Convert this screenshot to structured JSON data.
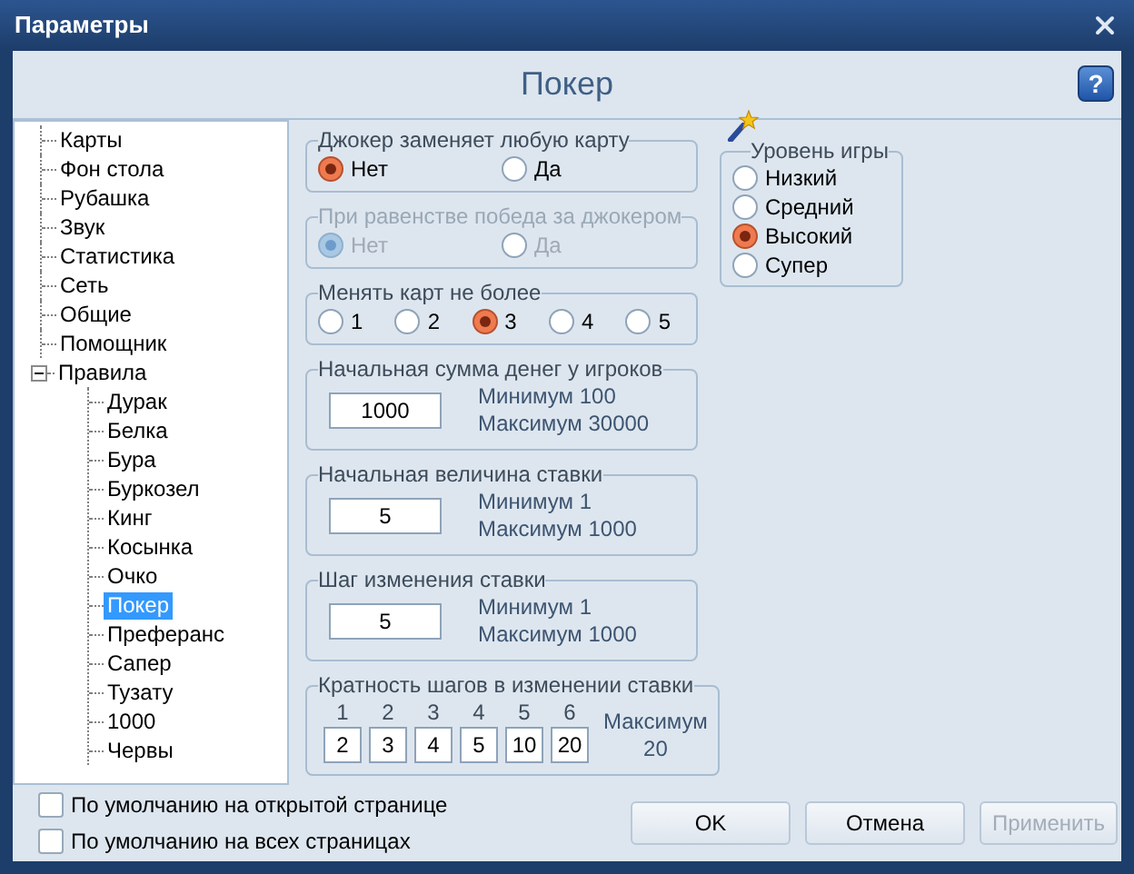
{
  "window": {
    "title": "Параметры"
  },
  "header": {
    "title": "Покер",
    "help": "?"
  },
  "tree": [
    {
      "label": "Карты",
      "selected": false
    },
    {
      "label": "Фон стола",
      "selected": false
    },
    {
      "label": "Рубашка",
      "selected": false
    },
    {
      "label": "Звук",
      "selected": false
    },
    {
      "label": "Статистика",
      "selected": false
    },
    {
      "label": "Сеть",
      "selected": false
    },
    {
      "label": "Общие",
      "selected": false
    },
    {
      "label": "Помощник",
      "selected": false
    },
    {
      "label": "Правила",
      "selected": false,
      "expanded": true,
      "children": [
        {
          "label": "Дурак",
          "selected": false
        },
        {
          "label": "Белка",
          "selected": false
        },
        {
          "label": "Бура",
          "selected": false
        },
        {
          "label": "Буркозел",
          "selected": false
        },
        {
          "label": "Кинг",
          "selected": false
        },
        {
          "label": "Косынка",
          "selected": false
        },
        {
          "label": "Очко",
          "selected": false
        },
        {
          "label": "Покер",
          "selected": true
        },
        {
          "label": "Преферанс",
          "selected": false
        },
        {
          "label": "Сапер",
          "selected": false
        },
        {
          "label": "Тузату",
          "selected": false
        },
        {
          "label": "1000",
          "selected": false
        },
        {
          "label": "Червы",
          "selected": false
        }
      ]
    }
  ],
  "groups": [
    {
      "kind": "radio",
      "legend": "Джокер заменяет любую карту",
      "disabled": false,
      "options": [
        {
          "label": "Нет",
          "selected": true
        },
        {
          "label": "Да",
          "selected": false
        }
      ]
    },
    {
      "kind": "radio",
      "legend": "При равенстве победа за джокером",
      "disabled": true,
      "options": [
        {
          "label": "Нет",
          "selected": true
        },
        {
          "label": "Да",
          "selected": false
        }
      ]
    },
    {
      "kind": "radio",
      "legend": "Менять карт не более",
      "disabled": false,
      "options": [
        {
          "label": "1",
          "selected": false
        },
        {
          "label": "2",
          "selected": false
        },
        {
          "label": "3",
          "selected": true
        },
        {
          "label": "4",
          "selected": false
        },
        {
          "label": "5",
          "selected": false
        }
      ]
    },
    {
      "kind": "number",
      "legend": "Начальная сумма денег у игроков",
      "value": "1000",
      "min": "Минимум 100",
      "max": "Максимум 30000"
    },
    {
      "kind": "number",
      "legend": "Начальная величина ставки",
      "value": "5",
      "min": "Минимум 1",
      "max": "Максимум 1000"
    },
    {
      "kind": "number",
      "legend": "Шаг изменения ставки",
      "value": "5",
      "min": "Минимум 1",
      "max": "Максимум 1000"
    },
    {
      "kind": "steps",
      "legend": "Кратность шагов в изменении ставки",
      "steps": [
        {
          "index": "1",
          "value": "2"
        },
        {
          "index": "2",
          "value": "3"
        },
        {
          "index": "3",
          "value": "4"
        },
        {
          "index": "4",
          "value": "5"
        },
        {
          "index": "5",
          "value": "10"
        },
        {
          "index": "6",
          "value": "20"
        }
      ],
      "max_label": "Максимум",
      "max_value": "20"
    }
  ],
  "level_group": {
    "legend": "Уровень игры",
    "options": [
      {
        "label": "Низкий",
        "selected": false
      },
      {
        "label": "Средний",
        "selected": false
      },
      {
        "label": "Высокий",
        "selected": true
      },
      {
        "label": "Супер",
        "selected": false
      }
    ]
  },
  "checkboxes": [
    {
      "label": "По умолчанию на открытой странице",
      "checked": false
    },
    {
      "label": "По умолчанию на всех страницах",
      "checked": false
    }
  ],
  "buttons": [
    {
      "label": "OK",
      "disabled": false
    },
    {
      "label": "Отмена",
      "disabled": false
    },
    {
      "label": "Применить",
      "disabled": true
    }
  ]
}
